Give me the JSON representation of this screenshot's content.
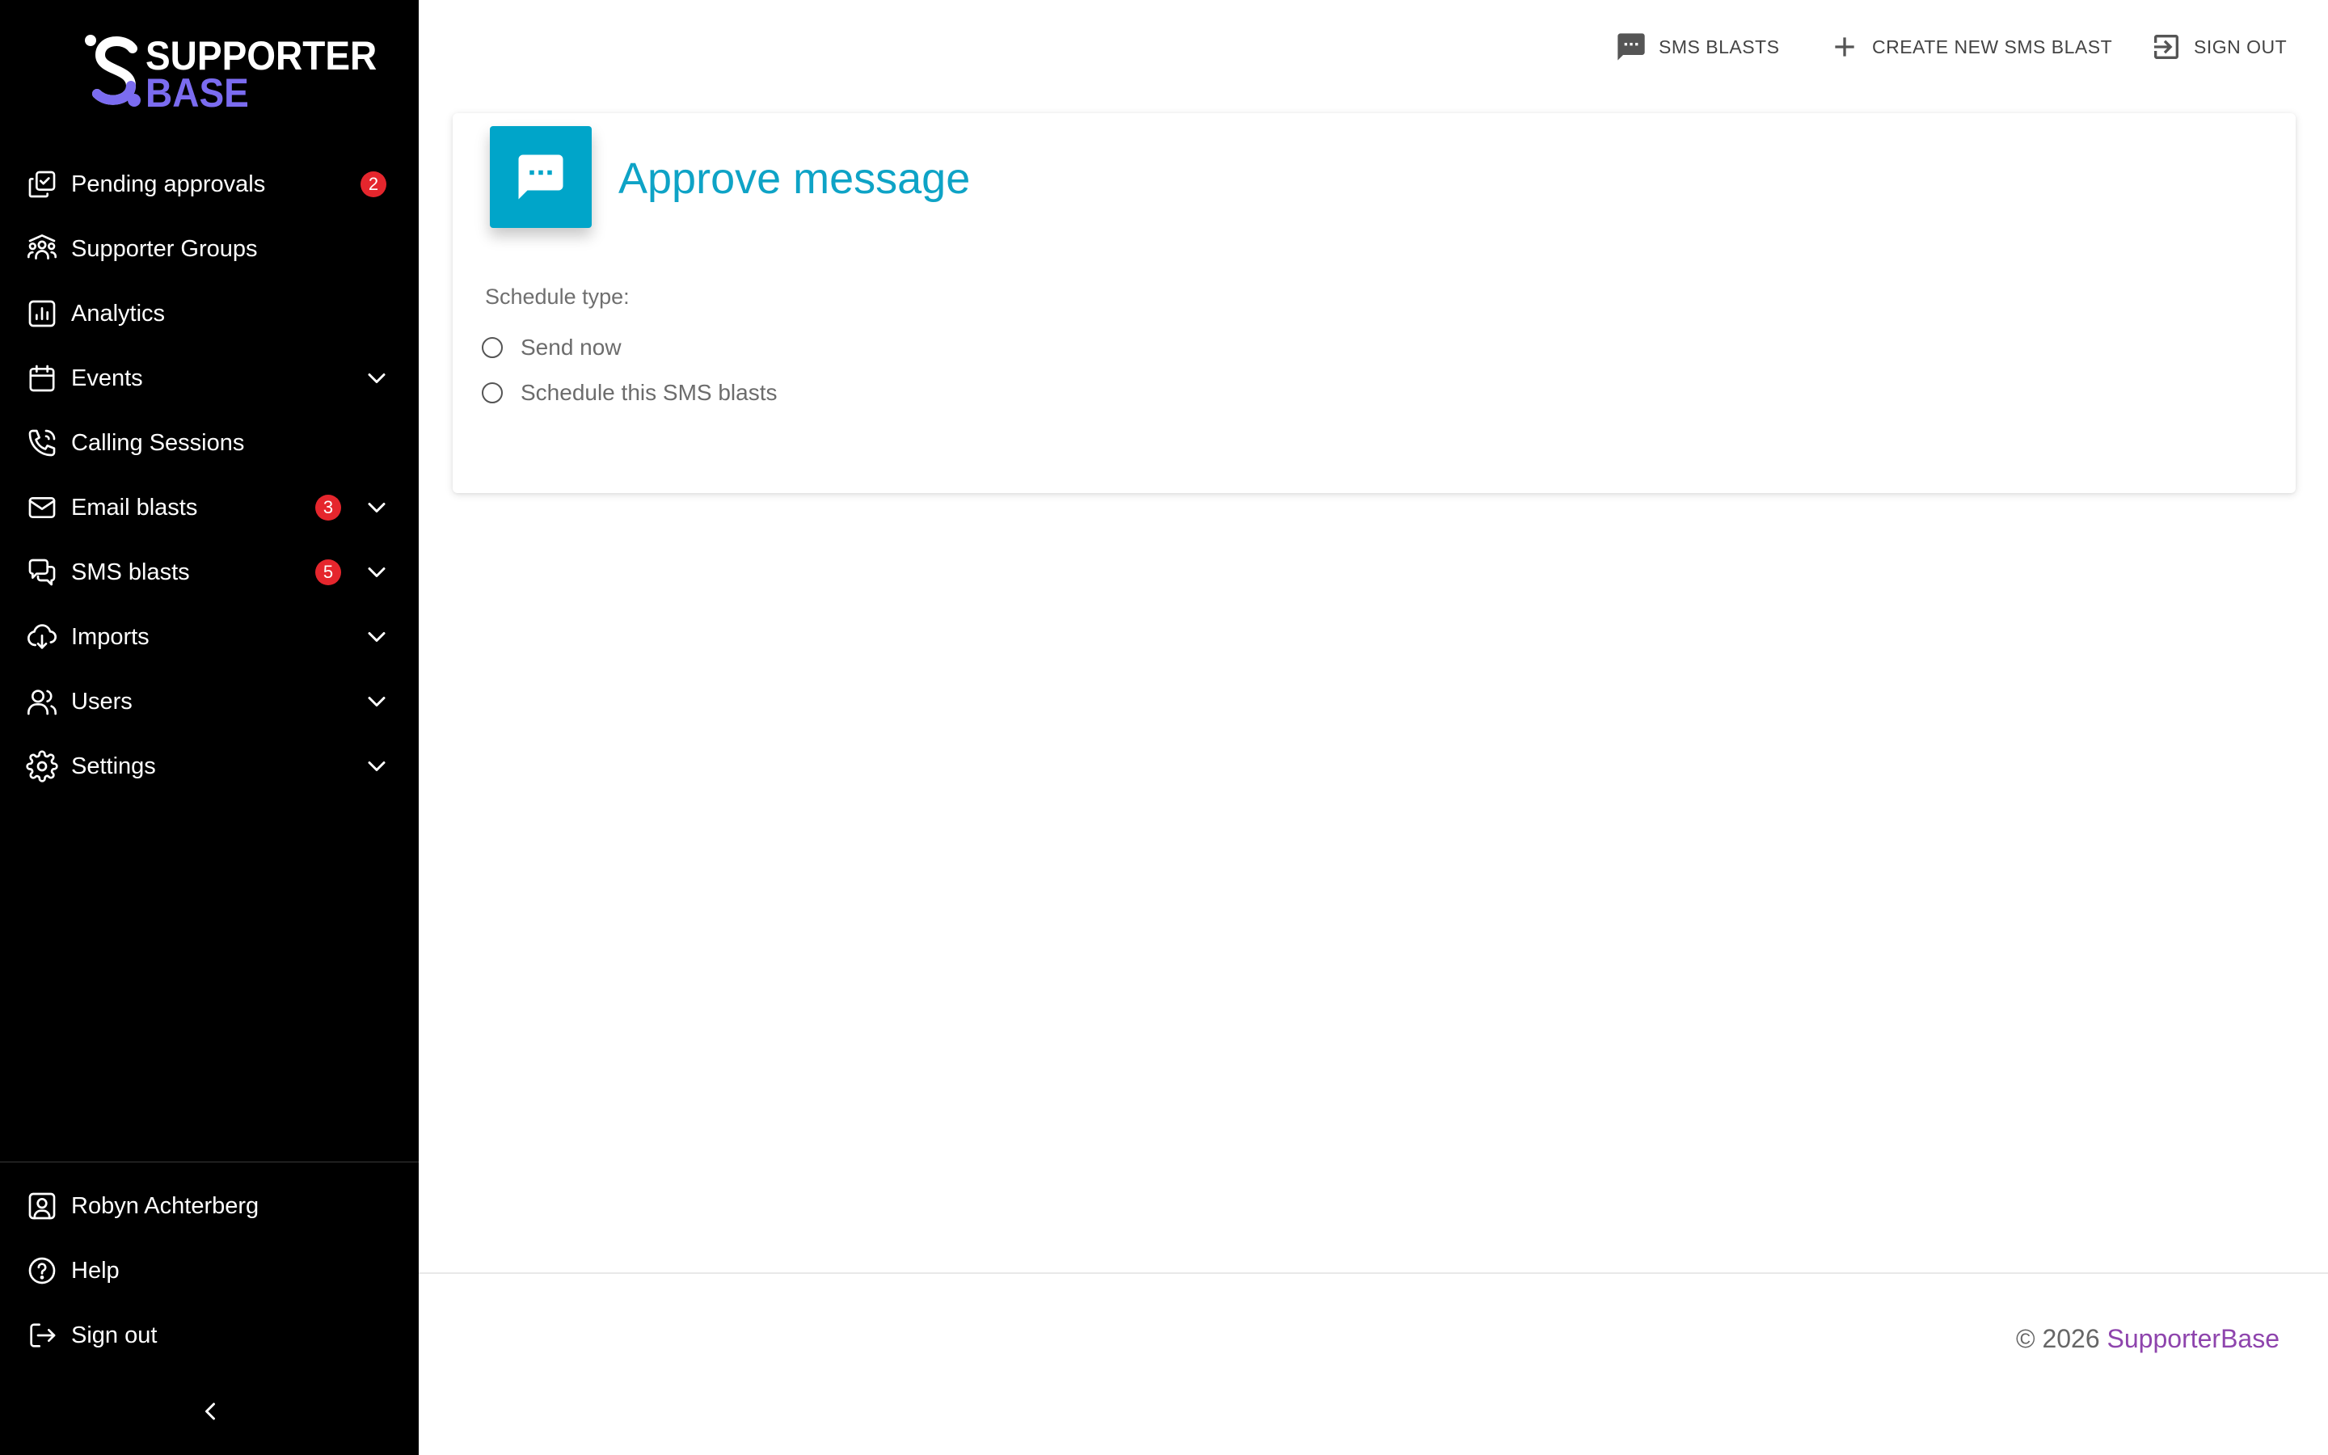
{
  "brand": {
    "word1": "SUPPORTER",
    "word2": "BASE",
    "accent_color": "#7b6cf0"
  },
  "sidebar": {
    "items": [
      {
        "label": "Pending approvals",
        "icon": "approvals-icon",
        "badge": "2",
        "has_chevron": false
      },
      {
        "label": "Supporter Groups",
        "icon": "groups-icon",
        "badge": null,
        "has_chevron": false
      },
      {
        "label": "Analytics",
        "icon": "analytics-icon",
        "badge": null,
        "has_chevron": false
      },
      {
        "label": "Events",
        "icon": "calendar-icon",
        "badge": null,
        "has_chevron": true
      },
      {
        "label": "Calling Sessions",
        "icon": "phone-icon",
        "badge": null,
        "has_chevron": false
      },
      {
        "label": "Email blasts",
        "icon": "mail-icon",
        "badge": "3",
        "has_chevron": true
      },
      {
        "label": "SMS blasts",
        "icon": "chat-icon",
        "badge": "5",
        "has_chevron": true
      },
      {
        "label": "Imports",
        "icon": "import-icon",
        "badge": null,
        "has_chevron": true
      },
      {
        "label": "Users",
        "icon": "users-icon",
        "badge": null,
        "has_chevron": true
      },
      {
        "label": "Settings",
        "icon": "gear-icon",
        "badge": null,
        "has_chevron": true
      }
    ],
    "bottom_items": [
      {
        "label": "Robyn Achterberg",
        "icon": "user-account-icon"
      },
      {
        "label": "Help",
        "icon": "help-icon"
      },
      {
        "label": "Sign out",
        "icon": "sign-out-icon"
      }
    ],
    "badge_color": "#e5262d"
  },
  "topbar": {
    "sms_blasts": "SMS BLASTS",
    "create_new": "CREATE NEW SMS BLAST",
    "sign_out": "SIGN OUT"
  },
  "card": {
    "title": "Approve message",
    "title_color": "#0ea3c6",
    "icon_bg": "#00a5c9",
    "schedule_label": "Schedule type:",
    "options": [
      "Send now",
      "Schedule this SMS blasts"
    ]
  },
  "footer": {
    "copyright": "© 2026",
    "link": "SupporterBase",
    "link_color": "#8e44ad"
  }
}
